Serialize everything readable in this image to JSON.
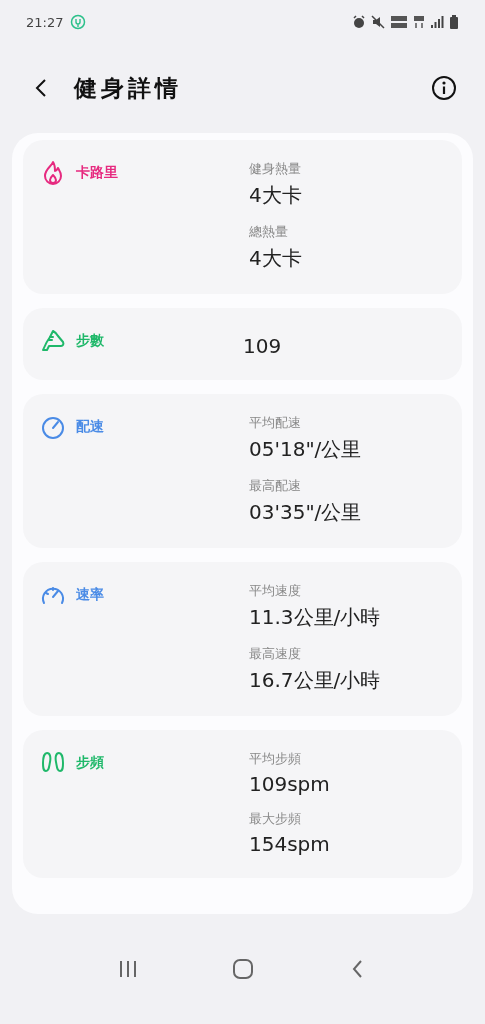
{
  "status_bar": {
    "time": "21:27"
  },
  "header": {
    "title": "健身詳情"
  },
  "cards": [
    {
      "kind": "calories",
      "title": "卡路里",
      "color": "#e6297f",
      "stats": [
        {
          "label": "健身熱量",
          "value": "4大卡"
        },
        {
          "label": "總熱量",
          "value": "4大卡"
        }
      ]
    },
    {
      "kind": "steps",
      "title": "步數",
      "color": "#1fb86a",
      "value": "109"
    },
    {
      "kind": "pace",
      "title": "配速",
      "color": "#4a8be6",
      "stats": [
        {
          "label": "平均配速",
          "value": "05'18\"/公里"
        },
        {
          "label": "最高配速",
          "value": "03'35\"/公里"
        }
      ]
    },
    {
      "kind": "speed",
      "title": "速率",
      "color": "#4a8be6",
      "stats": [
        {
          "label": "平均速度",
          "value": "11.3公里/小時"
        },
        {
          "label": "最高速度",
          "value": "16.7公里/小時"
        }
      ]
    },
    {
      "kind": "cadence",
      "title": "步頻",
      "color": "#1fb86a",
      "stats": [
        {
          "label": "平均步頻",
          "value": "109spm"
        },
        {
          "label": "最大步頻",
          "value": "154spm"
        }
      ]
    }
  ]
}
